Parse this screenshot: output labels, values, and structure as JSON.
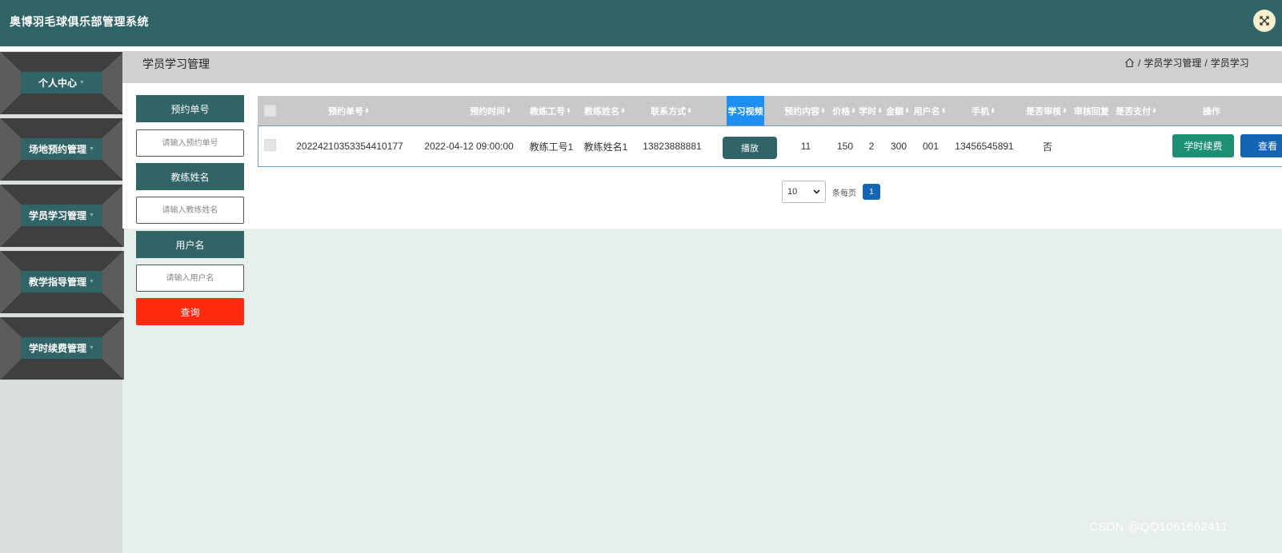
{
  "app": {
    "title": "奥博羽毛球俱乐部管理系统"
  },
  "sidebar": {
    "items": [
      {
        "label": "个人中心"
      },
      {
        "label": "场地预约管理"
      },
      {
        "label": "学员学习管理"
      },
      {
        "label": "教学指导管理"
      },
      {
        "label": "学时续费管理"
      }
    ]
  },
  "breadcrumb": {
    "title": "学员学习管理",
    "path": [
      "学员学习管理",
      "学员学习"
    ]
  },
  "search": {
    "fields": [
      {
        "label": "预约单号",
        "placeholder": "请输入预约单号"
      },
      {
        "label": "教练姓名",
        "placeholder": "请输入教练姓名"
      },
      {
        "label": "用户名",
        "placeholder": "请输入用户名"
      }
    ],
    "query_label": "查询"
  },
  "table": {
    "columns": [
      "预约单号",
      "预约时间",
      "教练工号",
      "教练姓名",
      "联系方式",
      "学习视频",
      "预约内容",
      "价格",
      "学时",
      "金额",
      "用户名",
      "手机",
      "是否审核",
      "审核回复",
      "是否支付",
      "操作"
    ],
    "rows": [
      {
        "order_no": "20224210353354410177",
        "time": "2022-04-12 09:00:00",
        "coach_id": "教练工号1",
        "coach_name": "教练姓名1",
        "contact": "13823888881",
        "video_action": "播放",
        "content": "11",
        "price": "150",
        "hours": "2",
        "amount": "300",
        "username": "001",
        "phone": "13456545891",
        "reviewed": "否",
        "reply": "",
        "paid": "",
        "actions": {
          "renew": "学时续费",
          "view": "查看"
        }
      }
    ]
  },
  "pagination": {
    "page_size": "10",
    "per_page_label": "条每页",
    "current_page": "1"
  },
  "watermark": "CSDN @QQ1061662411",
  "icons": {
    "fullscreen": "fullscreen-icon",
    "home": "home-icon",
    "sort": "sort-icon"
  },
  "colors": {
    "primary": "#316467",
    "danger": "#ff2a0f",
    "accent": "#1e8ff0",
    "success": "#1f8f74",
    "info": "#1565b5"
  }
}
